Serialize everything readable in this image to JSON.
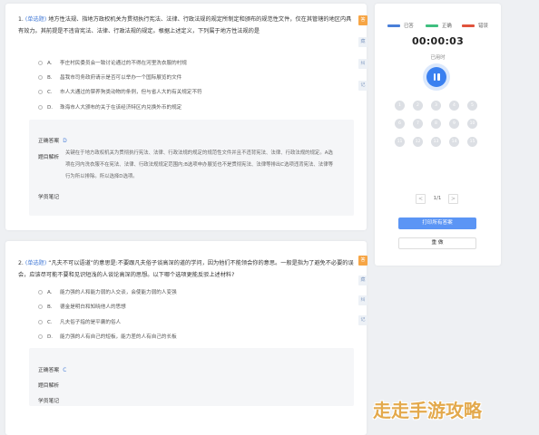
{
  "questions": [
    {
      "number": "1.",
      "tag": "(单选题)",
      "text": "地方性法规、指地方政权机关为贯彻执行宪法、法律、行政法规的规定所制定和颁布的规范性文件，仅在其管辖的地区内具有效力。其前提是不违背宪法、法律、行政法规的规定。根据上述定义，下列属于地方性法规的是",
      "options": [
        {
          "letter": "A.",
          "text": "李庄村民委员会一致讨论通过的不得在河里洗衣服的村规"
        },
        {
          "letter": "B.",
          "text": "昌我市司务政府请示是否可以举办一个国际展览的文件"
        },
        {
          "letter": "C.",
          "text": "市人大通过的禁养狗类动物的条例，但与省人大的有关规定不符"
        },
        {
          "letter": "D.",
          "text": "珠海市人大颁布的关于在该经济特区内兑换外币的规定"
        }
      ],
      "answer_label": "正确答案",
      "answer": "D",
      "analysis_label": "题目解析",
      "analysis": "关键在于地方政权机关为贯彻执行宪法、法律、行政法规的规定的规范性文件并且不违背宪法、法律、行政法规的规定。A选项在河内洗衣服不在宪法、法律、行政法规规定范围内;B选项申办展览也不是贯彻宪法、法律等排出C选项违背宪法、法律等行为所以排除。所以选择D选项。",
      "notes_label": "学员笔记",
      "side_buttons": [
        "答",
        "藏",
        "纠",
        "记"
      ]
    },
    {
      "number": "2.",
      "tag": "(单选题)",
      "text": "“凡夫不可以语道”的意思是:不要跟凡夫俗子谈高深的道的学问，因为他们不能领会你的意思。一般是指为了避免不必要的误会，应该尽可能不要和见识短浅的人谈论高深的思想。以下哪个选项更能反驳上述材料?",
      "options": [
        {
          "letter": "A.",
          "text": "能力强的人和能力弱的人交谈，会使能力弱的人变强"
        },
        {
          "letter": "B.",
          "text": "德金是明白和知晓他人的思想"
        },
        {
          "letter": "C.",
          "text": "凡夫俗子指的是平庸的俗人"
        },
        {
          "letter": "D.",
          "text": "能力强的人有自己的短板，能力差的人有自己的长板"
        }
      ],
      "answer_label": "正确答案",
      "answer": "C",
      "analysis_label": "题目解析",
      "notes_label": "学员笔记",
      "side_buttons": [
        "答",
        "藏",
        "纠",
        "记"
      ]
    }
  ],
  "panel": {
    "legend": [
      {
        "label": "已答",
        "color": "#4a7fd8"
      },
      {
        "label": "正确",
        "color": "#3fbf7f"
      },
      {
        "label": "错误",
        "color": "#e0533c"
      }
    ],
    "timer": "00:00:03",
    "used_label": "已用时",
    "question_numbers": [
      "1",
      "2",
      "3",
      "4",
      "5",
      "6",
      "7",
      "8",
      "9",
      "10",
      "11",
      "12",
      "13",
      "14",
      "15"
    ],
    "pager": {
      "prev": "<",
      "text": "1/1",
      "next": ">"
    },
    "print_button": "打印所有答案",
    "redo_button": "重 做"
  },
  "watermark": "走走手游攻略"
}
